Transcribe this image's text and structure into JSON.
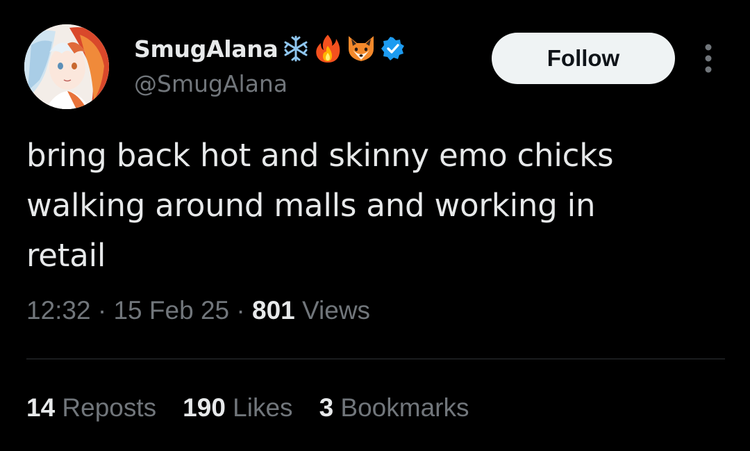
{
  "author": {
    "display_name": "SmugAlana",
    "handle": "@SmugAlana",
    "name_emojis": [
      "snowflake-icon",
      "fire-icon",
      "fox-icon"
    ],
    "verified": true,
    "verified_color": "#1d9bf0"
  },
  "follow_button": {
    "label": "Follow"
  },
  "tweet": {
    "text": "bring back hot and skinny emo chicks\nwalking around malls and working in\nretail"
  },
  "meta": {
    "time": "12:32",
    "separator": " · ",
    "date": "15 Feb 25",
    "views_count": "801",
    "views_label": " Views"
  },
  "stats": {
    "reposts_count": "14",
    "reposts_label": " Reposts",
    "likes_count": "190",
    "likes_label": " Likes",
    "bookmarks_count": "3",
    "bookmarks_label": " Bookmarks"
  },
  "colors": {
    "background": "#000000",
    "primary_text": "#e7e9ea",
    "secondary_text": "#71767b",
    "divider": "#2f3336",
    "follow_bg": "#eff3f4"
  }
}
